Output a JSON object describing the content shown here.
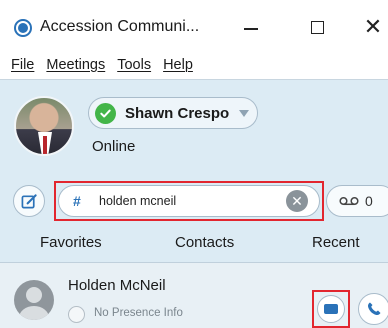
{
  "window": {
    "title": "Accession Communi...",
    "minimize_glyph": "—",
    "close_glyph": "✕"
  },
  "menu": [
    {
      "label": "File"
    },
    {
      "label": "Meetings"
    },
    {
      "label": "Tools"
    },
    {
      "label": "Help"
    }
  ],
  "profile": {
    "name": "Shawn Crespo",
    "status": "Online",
    "status_color": "#43b549"
  },
  "search": {
    "value": "holden mcneil",
    "hash_glyph": "#"
  },
  "voicemail": {
    "count": "0"
  },
  "tabs": [
    {
      "label": "Favorites"
    },
    {
      "label": "Contacts"
    },
    {
      "label": "Recent"
    }
  ],
  "contact": {
    "name": "Holden McNeil",
    "presence": "No Presence Info"
  },
  "colors": {
    "accent": "#2a72b8",
    "highlight": "#e2262f",
    "background": "#dcebf4"
  },
  "icons": {
    "app": "accession-logo-icon",
    "compose": "compose-icon",
    "clear": "clear-icon",
    "voicemail": "voicemail-icon",
    "chat": "chat-icon",
    "call": "phone-icon"
  }
}
